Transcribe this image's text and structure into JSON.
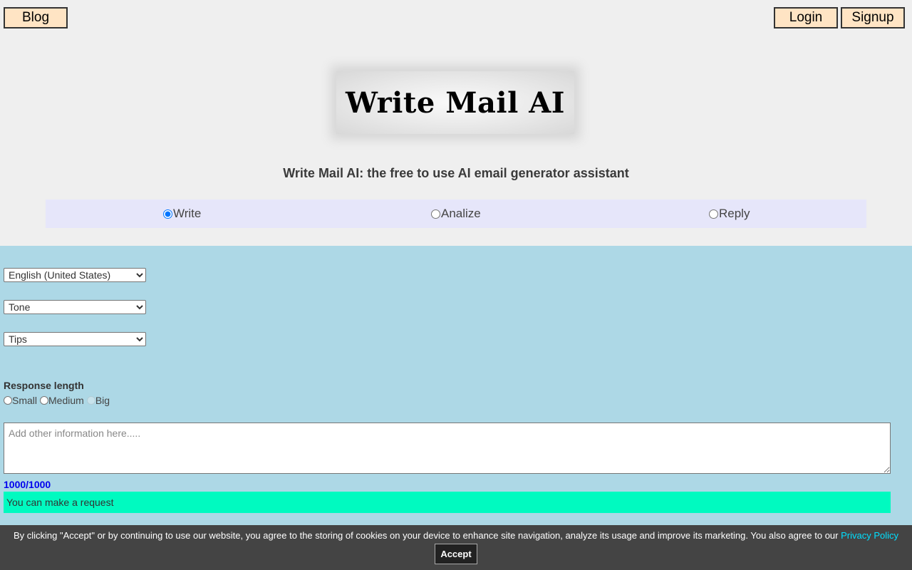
{
  "nav": {
    "blog_label": "Blog",
    "login_label": "Login",
    "signup_label": "Signup"
  },
  "logo_text": "Write Mail AI",
  "subtitle": "Write Mail AI: the free to use AI email generator assistant",
  "modes": [
    {
      "label": "Write",
      "selected": true
    },
    {
      "label": "Analize",
      "selected": false
    },
    {
      "label": "Reply",
      "selected": false
    }
  ],
  "selects": {
    "language": "English (United States)",
    "tone": "Tone",
    "tips": "Tips"
  },
  "response_length": {
    "label": "Response length",
    "options": [
      "Small",
      "Medium",
      "Big"
    ]
  },
  "info_input": {
    "placeholder": "Add other information here.....",
    "value": ""
  },
  "counter": "1000/1000",
  "status_text": "You can make a request",
  "cookie": {
    "message": "By clicking \"Accept\" or by continuing to use our website, you agree to the storing of cookies on your device to enhance site navigation, analyze its usage and improve its marketing. You also agree to our",
    "link_text": "Privacy Policy",
    "accept_label": "Accept"
  },
  "colors": {
    "nav_button_bg": "#ffe4c4",
    "mode_bar_bg": "#e6e6fa",
    "main_bg": "#add8e6",
    "status_bg": "#00fac0",
    "counter_color": "#0000ee",
    "cookie_bg": "#444444",
    "link_color": "#00e0ff"
  }
}
